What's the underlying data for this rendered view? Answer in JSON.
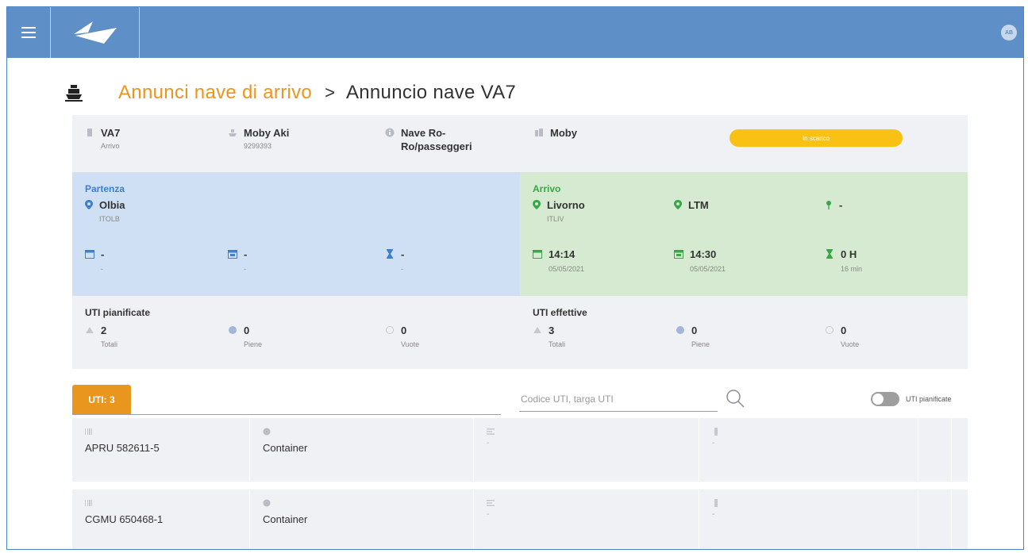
{
  "header": {
    "avatar_initials": "AB"
  },
  "breadcrumb": {
    "parent": "Annunci nave di arrivo",
    "separator": ">",
    "current": "Annuncio nave VA7"
  },
  "ship": {
    "code": "VA7",
    "direction": "Arrivo",
    "name": "Moby Aki",
    "imo": "9299393",
    "type_line1": "Nave Ro-",
    "type_line2": "Ro/passeggeri",
    "company": "Moby",
    "status": "In scarico",
    "status_color": "#f8c113"
  },
  "departure": {
    "title": "Partenza",
    "port": "Olbia",
    "port_code": "ITOLB",
    "times": [
      {
        "icon": "calendar-icon",
        "value": "-",
        "sub": "-"
      },
      {
        "icon": "calendar-check-icon",
        "value": "-",
        "sub": "-"
      },
      {
        "icon": "hourglass-icon",
        "value": "-",
        "sub": "-"
      }
    ]
  },
  "arrival": {
    "title": "Arrivo",
    "port": "Livorno",
    "port_code": "ITLIV",
    "terminal": "LTM",
    "berth": "-",
    "times": [
      {
        "icon": "calendar-icon",
        "value": "14:14",
        "sub": "05/05/2021"
      },
      {
        "icon": "calendar-check-icon",
        "value": "14:30",
        "sub": "05/05/2021"
      },
      {
        "icon": "hourglass-icon",
        "value": "0 H",
        "sub": "16 min"
      }
    ]
  },
  "uti_planned": {
    "title": "UTI pianificate",
    "total": "2",
    "total_label": "Totali",
    "full": "0",
    "full_label": "Piene",
    "empty": "0",
    "empty_label": "Vuote"
  },
  "uti_actual": {
    "title": "UTI effettive",
    "total": "3",
    "total_label": "Totali",
    "full": "0",
    "full_label": "Piene",
    "empty": "0",
    "empty_label": "Vuote"
  },
  "tabs": {
    "uti": "UTI: 3"
  },
  "search": {
    "placeholder": "Codice UTI, targa UTI"
  },
  "toggle": {
    "label": "UTI pianificate",
    "on": false
  },
  "rows": [
    {
      "code": "APRU 582611-5",
      "type": "Container",
      "col3": "-",
      "col4": "-"
    },
    {
      "code": "CGMU 650468-1",
      "type": "Container",
      "col3": "-",
      "col4": "-"
    }
  ],
  "colors": {
    "topbar": "#5e8fc7",
    "accent": "#e8961e",
    "departure_bg": "#cfe0f5",
    "arrival_bg": "#d5ead0",
    "departure_title": "#3f7fd0",
    "arrival_title": "#3aa549"
  }
}
